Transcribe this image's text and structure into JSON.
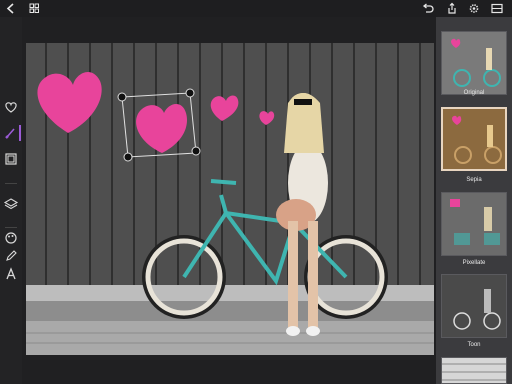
{
  "toolbar": {
    "left_icons": [
      "back-chevron-icon",
      "grid-icon"
    ],
    "right_icons": [
      "undo-icon",
      "share-icon",
      "settings-icon",
      "compare-icon"
    ]
  },
  "left_tools": [
    "heart-icon",
    "brush-icon",
    "frame-icon",
    "layers-icon",
    "palette-icon",
    "pen-icon",
    "text-icon"
  ],
  "filters": [
    {
      "label": "Original",
      "selected": false
    },
    {
      "label": "Sepia",
      "selected": true
    },
    {
      "label": "Pixellate",
      "selected": false
    },
    {
      "label": "Toon",
      "selected": false
    }
  ],
  "colors": {
    "accent": "#9b5bd6",
    "heart": "#e8449b",
    "bike": "#3fb5b0"
  }
}
